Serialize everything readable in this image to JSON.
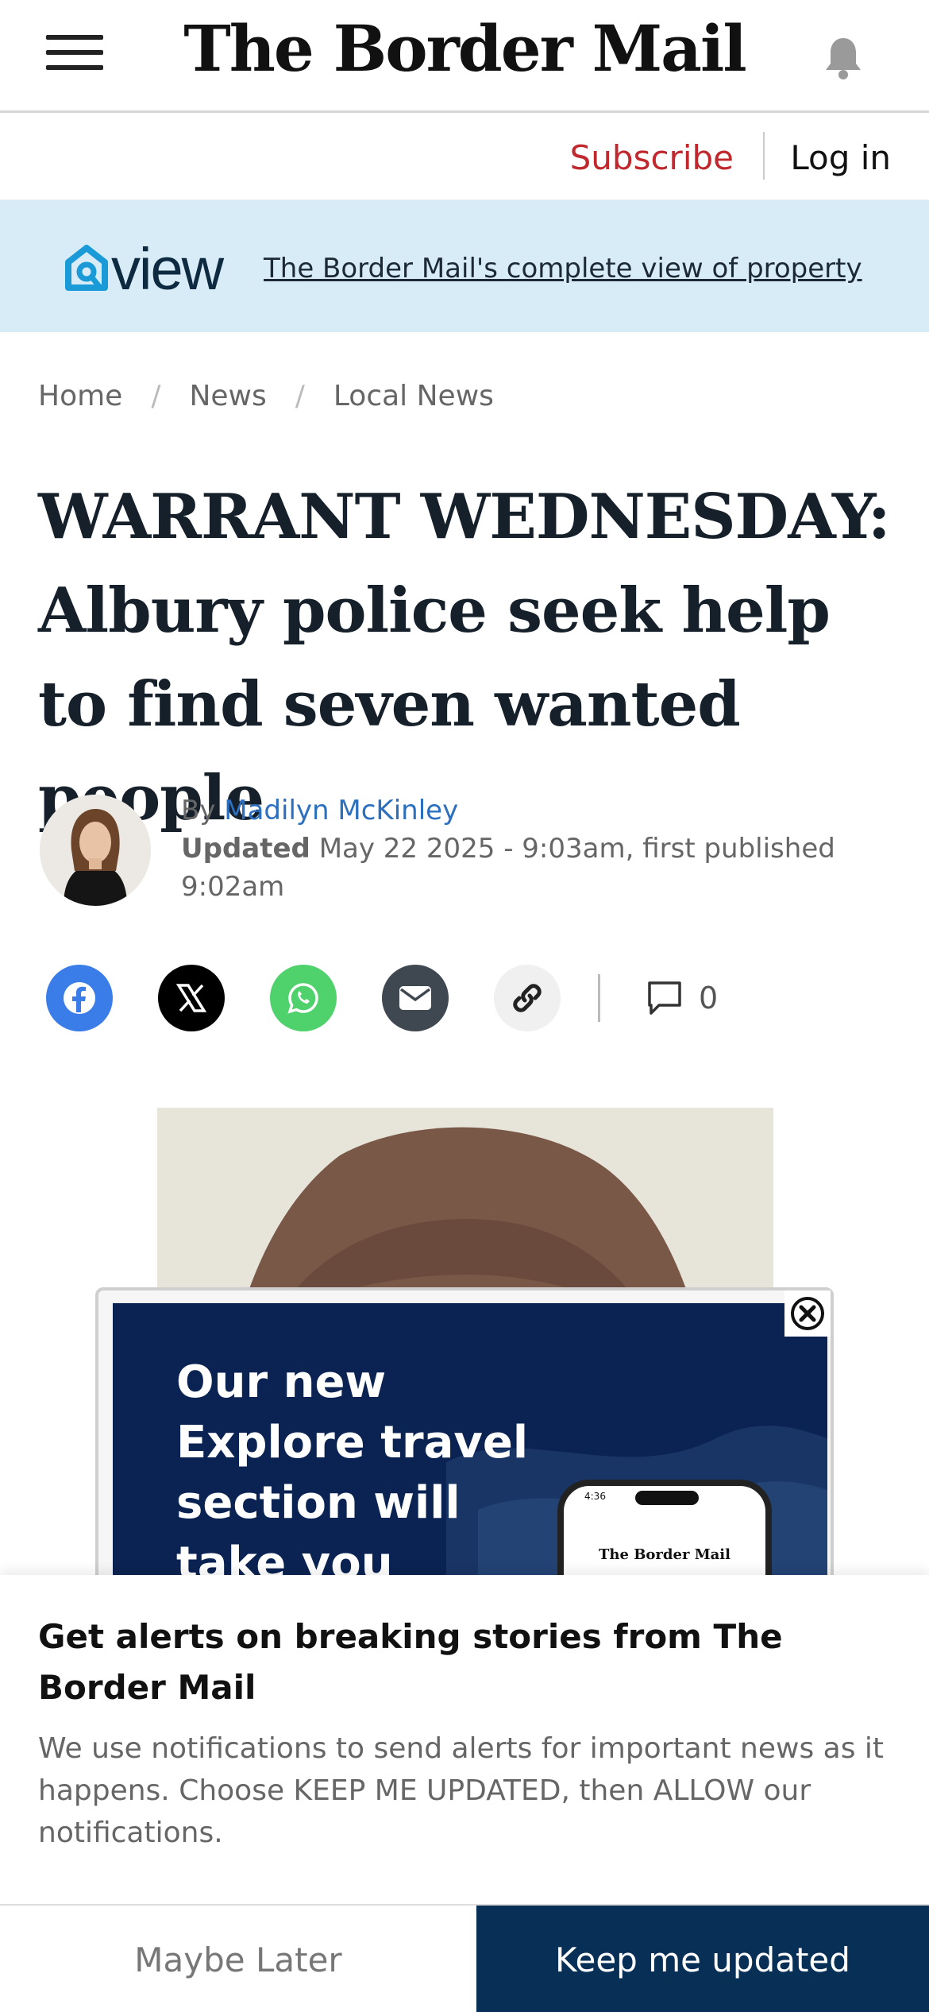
{
  "header": {
    "logo_text": "The Border Mail"
  },
  "account": {
    "subscribe_label": "Subscribe",
    "login_label": "Log in"
  },
  "view_banner": {
    "logo_text": "view",
    "link_text": "The Border Mail's complete view of property"
  },
  "breadcrumb": {
    "items": [
      "Home",
      "News",
      "Local News"
    ]
  },
  "article": {
    "headline": "WARRANT WEDNESDAY: Albury police seek help to find seven wanted people",
    "byline_prefix": "By",
    "author": "Madilyn McKinley",
    "updated_label": "Updated",
    "updated_text": "May 22 2025 - 9:03am, first published 9:02am",
    "comment_count": "0"
  },
  "share": {
    "icons": [
      "facebook-icon",
      "x-icon",
      "whatsapp-icon",
      "email-icon",
      "link-icon",
      "comment-icon"
    ]
  },
  "ad": {
    "text": "Our new Explore travel section will take you places!",
    "phone_time": "4:36",
    "phone_masthead": "The Border Mail"
  },
  "notification": {
    "title": "Get alerts on breaking stories from The Border Mail",
    "body": "We use notifications to send alerts for important news as it happens. Choose KEEP ME UPDATED, then ALLOW our notifications.",
    "later_label": "Maybe Later",
    "keep_label": "Keep me updated"
  },
  "colors": {
    "subscribe_red": "#c0282d",
    "author_blue": "#2c6fbf",
    "view_banner_bg": "#d8ecf8",
    "keep_button_bg": "#082f56",
    "ad_bg": "#0a2350"
  }
}
